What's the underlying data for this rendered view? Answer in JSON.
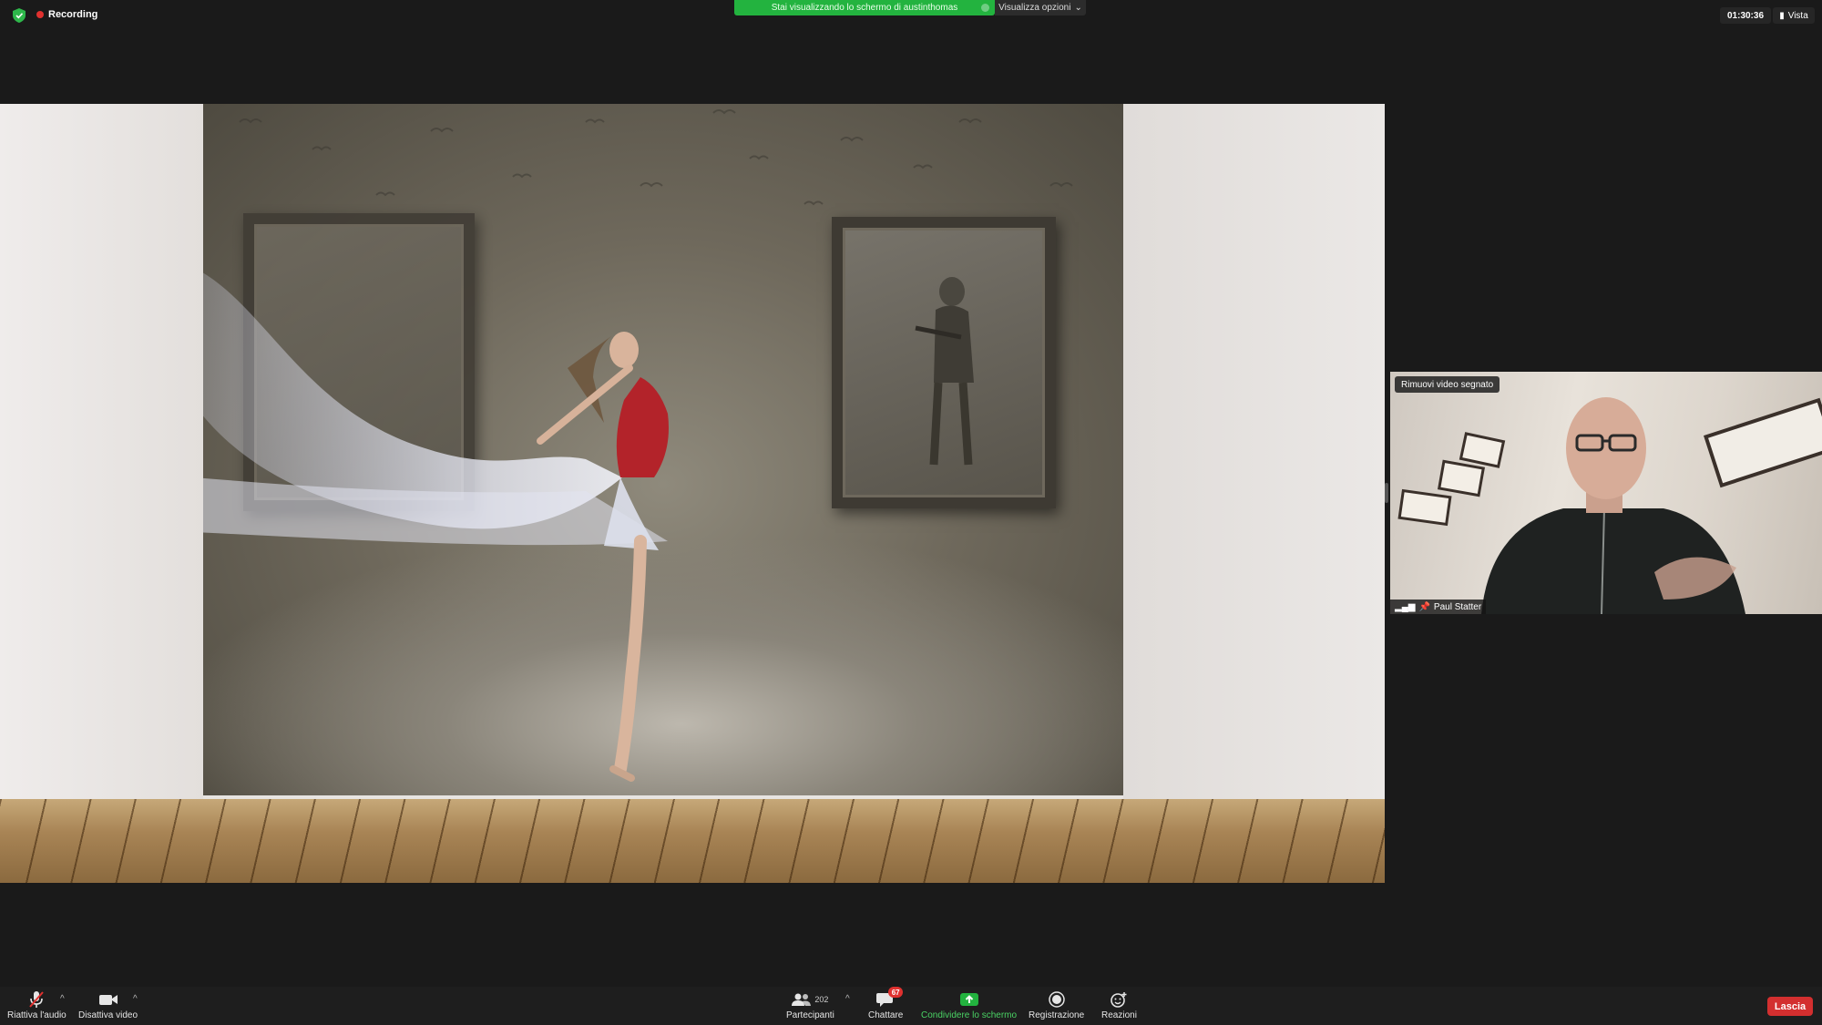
{
  "top_bar": {
    "recording_label": "Recording",
    "share_banner_text": "Stai visualizzando lo schermo di austinthomas",
    "view_options_label": "Visualizza opzioni",
    "meeting_timer": "01:30:36",
    "view_button_label": "Vista"
  },
  "video_tile": {
    "unpin_label": "Rimuovi video segnato",
    "participant_name": "Paul Statter"
  },
  "toolbar": {
    "mute_label": "Riattiva l'audio",
    "video_label": "Disattiva video",
    "participants_label": "Partecipanti",
    "participants_count": "202",
    "chat_label": "Chattare",
    "chat_badge": "67",
    "share_label": "Condividere lo schermo",
    "record_label": "Registrazione",
    "reactions_label": "Reazioni",
    "leave_label": "Lascia"
  },
  "colors": {
    "share_green": "#23b33f",
    "recording_red": "#e0312f",
    "leave_red": "#d32f2f"
  }
}
